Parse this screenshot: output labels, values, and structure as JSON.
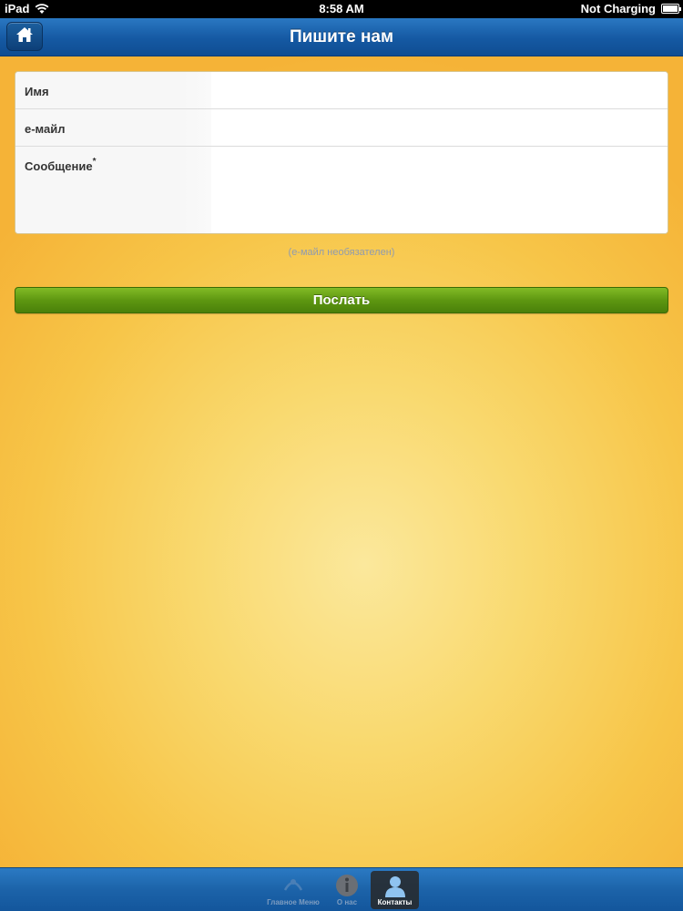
{
  "status_bar": {
    "device": "iPad",
    "time": "8:58 AM",
    "battery_status": "Not Charging"
  },
  "nav_bar": {
    "title": "Пишите нам",
    "home_icon": "house-icon"
  },
  "form": {
    "fields": [
      {
        "label": "Имя",
        "value": "",
        "placeholder": ""
      },
      {
        "label": "е-майл",
        "value": "",
        "placeholder": ""
      },
      {
        "label": "Сообщение",
        "required_mark": "*",
        "value": "",
        "placeholder": ""
      }
    ],
    "hint": "(е-майл необязателен)",
    "submit_label": "Послать"
  },
  "tab_bar": {
    "tabs": [
      {
        "label": "Главное Меню",
        "icon": "main-menu-icon",
        "active": false
      },
      {
        "label": "О нас",
        "icon": "info-icon",
        "active": false
      },
      {
        "label": "Контакты",
        "icon": "person-icon",
        "active": true
      }
    ]
  },
  "colors": {
    "nav_blue": "#1559a3",
    "send_green": "#5e9711",
    "background_orange": "#f7c548"
  }
}
